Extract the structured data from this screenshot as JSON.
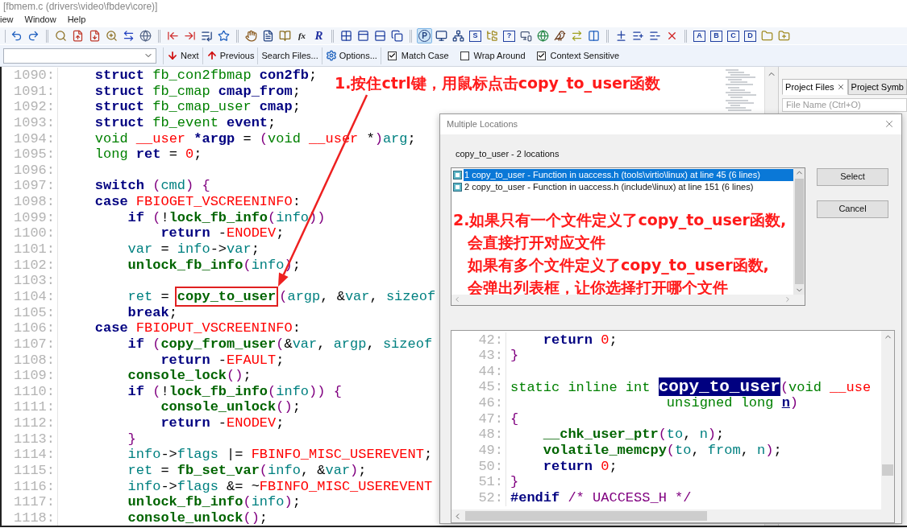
{
  "window": {
    "title": "[fbmem.c (drivers\\video\\fbdev\\core)]"
  },
  "menu": [
    "iew",
    "Window",
    "Help"
  ],
  "toolbar_groups": [
    [
      {
        "pressed": false
      },
      {
        "pressed": false
      }
    ],
    [
      {
        "pressed": false
      },
      {
        "pressed": false
      },
      {
        "pressed": false
      },
      {
        "pressed": false
      },
      {
        "pressed": false
      },
      {
        "pressed": false
      }
    ],
    [
      {
        "pressed": false
      },
      {
        "pressed": false
      },
      {
        "pressed": false
      },
      {
        "pressed": false
      }
    ],
    [
      {
        "pressed": false
      },
      {
        "pressed": false
      },
      {
        "pressed": false
      },
      {
        "pressed": false,
        "label": "fx"
      },
      {
        "pressed": false,
        "label": "R"
      }
    ],
    [
      {
        "pressed": false
      },
      {
        "pressed": false
      },
      {
        "pressed": false
      },
      {
        "pressed": false
      }
    ],
    [
      {
        "pressed": true,
        "label": "P"
      },
      {
        "pressed": false
      },
      {
        "pressed": false
      },
      {
        "pressed": false,
        "label": "S"
      },
      {
        "pressed": false
      },
      {
        "pressed": false,
        "label": "?"
      },
      {
        "pressed": false
      },
      {
        "pressed": false
      },
      {
        "pressed": false
      },
      {
        "pressed": false
      },
      {
        "pressed": false
      }
    ],
    [
      {
        "pressed": false
      },
      {
        "pressed": false
      },
      {
        "pressed": false
      },
      {
        "pressed": false
      }
    ],
    [
      {
        "pressed": false,
        "label": "A"
      },
      {
        "pressed": false,
        "label": "B"
      },
      {
        "pressed": false,
        "label": "C"
      },
      {
        "pressed": false,
        "label": "D"
      },
      {
        "pressed": false
      },
      {
        "pressed": false
      }
    ]
  ],
  "search_bar": {
    "buttons": [
      {
        "kind": "next",
        "label": "Next"
      },
      {
        "kind": "previous",
        "label": "Previous"
      },
      {
        "kind": "plain",
        "label": "Search Files..."
      },
      {
        "kind": "options",
        "label": "Options..."
      }
    ],
    "options": [
      {
        "label": "Match Case",
        "checked": true
      },
      {
        "label": "Wrap Around",
        "checked": false
      },
      {
        "label": "Context Sensitive",
        "checked": true
      }
    ]
  },
  "editor": {
    "lines": [
      {
        "number": "1090:",
        "tokens": [
          {
            "kind": "keyword",
            "text": "    struct "
          },
          {
            "kind": "type",
            "text": "fb_con2fbmap "
          },
          {
            "kind": "name",
            "text": "con2fb"
          },
          {
            "kind": "plain",
            "text": ";"
          }
        ]
      },
      {
        "number": "1091:",
        "tokens": [
          {
            "kind": "keyword",
            "text": "    struct "
          },
          {
            "kind": "type",
            "text": "fb_cmap "
          },
          {
            "kind": "name",
            "text": "cmap_from"
          },
          {
            "kind": "plain",
            "text": ";"
          }
        ]
      },
      {
        "number": "1092:",
        "tokens": [
          {
            "kind": "keyword",
            "text": "    struct "
          },
          {
            "kind": "type",
            "text": "fb_cmap_user "
          },
          {
            "kind": "name",
            "text": "cmap"
          },
          {
            "kind": "plain",
            "text": ";"
          }
        ]
      },
      {
        "number": "1093:",
        "tokens": [
          {
            "kind": "keyword",
            "text": "    struct "
          },
          {
            "kind": "type",
            "text": "fb_event "
          },
          {
            "kind": "name",
            "text": "event"
          },
          {
            "kind": "plain",
            "text": ";"
          }
        ]
      },
      {
        "number": "1094:",
        "tokens": [
          {
            "kind": "type",
            "text": "    void "
          },
          {
            "kind": "const",
            "text": "__user "
          },
          {
            "kind": "name",
            "text": "*argp"
          },
          {
            "kind": "plain",
            "text": " = "
          },
          {
            "kind": "paren",
            "text": "("
          },
          {
            "kind": "type",
            "text": "void "
          },
          {
            "kind": "const",
            "text": "__user "
          },
          {
            "kind": "plain",
            "text": "*"
          },
          {
            "kind": "paren",
            "text": ")"
          },
          {
            "kind": "ident",
            "text": "arg"
          },
          {
            "kind": "plain",
            "text": ";"
          }
        ]
      },
      {
        "number": "1095:",
        "tokens": [
          {
            "kind": "type",
            "text": "    long "
          },
          {
            "kind": "name",
            "text": "ret"
          },
          {
            "kind": "plain",
            "text": " = "
          },
          {
            "kind": "const",
            "text": "0"
          },
          {
            "kind": "plain",
            "text": ";"
          }
        ]
      },
      {
        "number": "1096:"
      },
      {
        "number": "1097:",
        "tokens": [
          {
            "kind": "keyword",
            "text": "    switch "
          },
          {
            "kind": "paren",
            "text": "("
          },
          {
            "kind": "ident",
            "text": "cmd"
          },
          {
            "kind": "paren",
            "text": ") {"
          }
        ]
      },
      {
        "number": "1098:",
        "tokens": [
          {
            "kind": "keyword",
            "text": "    case "
          },
          {
            "kind": "const",
            "text": "FBIOGET_VSCREENINFO"
          },
          {
            "kind": "plain",
            "text": ":"
          }
        ]
      },
      {
        "number": "1099:",
        "tokens": [
          {
            "kind": "keyword",
            "text": "        if "
          },
          {
            "kind": "paren",
            "text": "("
          },
          {
            "kind": "plain",
            "text": "!"
          },
          {
            "kind": "func",
            "text": "lock_fb_info"
          },
          {
            "kind": "paren",
            "text": "("
          },
          {
            "kind": "ident",
            "text": "info"
          },
          {
            "kind": "paren",
            "text": "))"
          }
        ]
      },
      {
        "number": "1100:",
        "tokens": [
          {
            "kind": "keyword",
            "text": "            return "
          },
          {
            "kind": "plain",
            "text": "-"
          },
          {
            "kind": "const",
            "text": "ENODEV"
          },
          {
            "kind": "plain",
            "text": ";"
          }
        ]
      },
      {
        "number": "1101:",
        "tokens": [
          {
            "kind": "ident",
            "text": "        var"
          },
          {
            "kind": "plain",
            "text": " = "
          },
          {
            "kind": "ident",
            "text": "info"
          },
          {
            "kind": "plain",
            "text": "->"
          },
          {
            "kind": "ident",
            "text": "var"
          },
          {
            "kind": "plain",
            "text": ";"
          }
        ]
      },
      {
        "number": "1102:",
        "tokens": [
          {
            "kind": "func",
            "text": "        unlock_fb_info"
          },
          {
            "kind": "paren",
            "text": "("
          },
          {
            "kind": "ident",
            "text": "info"
          },
          {
            "kind": "paren",
            "text": ")"
          },
          {
            "kind": "plain",
            "text": ";"
          }
        ]
      },
      {
        "number": "1103:"
      },
      {
        "number": "1104:",
        "tokens": [
          {
            "kind": "ident",
            "text": "        ret"
          },
          {
            "kind": "plain",
            "text": " = "
          },
          {
            "kind": "boxed",
            "text": "copy_to_user"
          },
          {
            "kind": "paren",
            "text": "("
          },
          {
            "kind": "ident",
            "text": "argp"
          },
          {
            "kind": "plain",
            "text": ", &"
          },
          {
            "kind": "ident",
            "text": "var"
          },
          {
            "kind": "plain",
            "text": ", "
          },
          {
            "kind": "ident",
            "text": "sizeof"
          }
        ]
      },
      {
        "number": "1105:",
        "tokens": [
          {
            "kind": "keyword",
            "text": "        break"
          },
          {
            "kind": "plain",
            "text": ";"
          }
        ]
      },
      {
        "number": "1106:",
        "tokens": [
          {
            "kind": "keyword",
            "text": "    case "
          },
          {
            "kind": "const",
            "text": "FBIOPUT_VSCREENINFO"
          },
          {
            "kind": "plain",
            "text": ":"
          }
        ]
      },
      {
        "number": "1107:",
        "tokens": [
          {
            "kind": "keyword",
            "text": "        if "
          },
          {
            "kind": "paren",
            "text": "("
          },
          {
            "kind": "func",
            "text": "copy_from_user"
          },
          {
            "kind": "paren",
            "text": "("
          },
          {
            "kind": "plain",
            "text": "&"
          },
          {
            "kind": "ident",
            "text": "var"
          },
          {
            "kind": "plain",
            "text": ", "
          },
          {
            "kind": "ident",
            "text": "argp"
          },
          {
            "kind": "plain",
            "text": ", "
          },
          {
            "kind": "ident",
            "text": "sizeof"
          }
        ]
      },
      {
        "number": "1108:",
        "tokens": [
          {
            "kind": "keyword",
            "text": "            return "
          },
          {
            "kind": "plain",
            "text": "-"
          },
          {
            "kind": "const",
            "text": "EFAULT"
          },
          {
            "kind": "plain",
            "text": ";"
          }
        ]
      },
      {
        "number": "1109:",
        "tokens": [
          {
            "kind": "func",
            "text": "        console_lock"
          },
          {
            "kind": "paren",
            "text": "()"
          },
          {
            "kind": "plain",
            "text": ";"
          }
        ]
      },
      {
        "number": "1110:",
        "tokens": [
          {
            "kind": "keyword",
            "text": "        if "
          },
          {
            "kind": "paren",
            "text": "("
          },
          {
            "kind": "plain",
            "text": "!"
          },
          {
            "kind": "func",
            "text": "lock_fb_info"
          },
          {
            "kind": "paren",
            "text": "("
          },
          {
            "kind": "ident",
            "text": "info"
          },
          {
            "kind": "paren",
            "text": ")) {"
          }
        ]
      },
      {
        "number": "1111:",
        "tokens": [
          {
            "kind": "func",
            "text": "            console_unlock"
          },
          {
            "kind": "paren",
            "text": "()"
          },
          {
            "kind": "plain",
            "text": ";"
          }
        ]
      },
      {
        "number": "1112:",
        "tokens": [
          {
            "kind": "keyword",
            "text": "            return "
          },
          {
            "kind": "plain",
            "text": "-"
          },
          {
            "kind": "const",
            "text": "ENODEV"
          },
          {
            "kind": "plain",
            "text": ";"
          }
        ]
      },
      {
        "number": "1113:",
        "tokens": [
          {
            "kind": "paren",
            "text": "        }"
          }
        ]
      },
      {
        "number": "1114:",
        "tokens": [
          {
            "kind": "ident",
            "text": "        info"
          },
          {
            "kind": "plain",
            "text": "->"
          },
          {
            "kind": "ident",
            "text": "flags"
          },
          {
            "kind": "plain",
            "text": " |= "
          },
          {
            "kind": "const",
            "text": "FBINFO_MISC_USEREVENT"
          },
          {
            "kind": "plain",
            "text": ";"
          }
        ]
      },
      {
        "number": "1115:",
        "tokens": [
          {
            "kind": "ident",
            "text": "        ret"
          },
          {
            "kind": "plain",
            "text": " = "
          },
          {
            "kind": "func",
            "text": "fb_set_var"
          },
          {
            "kind": "paren",
            "text": "("
          },
          {
            "kind": "ident",
            "text": "info"
          },
          {
            "kind": "plain",
            "text": ", &"
          },
          {
            "kind": "ident",
            "text": "var"
          },
          {
            "kind": "paren",
            "text": ")"
          },
          {
            "kind": "plain",
            "text": ";"
          }
        ]
      },
      {
        "number": "1116:",
        "tokens": [
          {
            "kind": "ident",
            "text": "        info"
          },
          {
            "kind": "plain",
            "text": "->"
          },
          {
            "kind": "ident",
            "text": "flags"
          },
          {
            "kind": "plain",
            "text": " &= ~"
          },
          {
            "kind": "const",
            "text": "FBINFO_MISC_USEREVENT"
          }
        ]
      },
      {
        "number": "1117:",
        "tokens": [
          {
            "kind": "func",
            "text": "        unlock_fb_info"
          },
          {
            "kind": "paren",
            "text": "("
          },
          {
            "kind": "ident",
            "text": "info"
          },
          {
            "kind": "paren",
            "text": ")"
          },
          {
            "kind": "plain",
            "text": ";"
          }
        ]
      },
      {
        "number": "1118:",
        "tokens": [
          {
            "kind": "func",
            "text": "        console_unlock"
          },
          {
            "kind": "paren",
            "text": "()"
          },
          {
            "kind": "plain",
            "text": ";"
          }
        ]
      }
    ]
  },
  "project_panel": {
    "tabs": [
      {
        "label": "Project Files",
        "selected": true
      },
      {
        "label": "Project Symb",
        "selected": false
      }
    ],
    "search": {
      "placeholder": "File Name (Ctrl+O)"
    }
  },
  "dialog": {
    "title": "Multiple Locations",
    "summary": "copy_to_user - 2 locations",
    "locations": [
      {
        "text": "1 copy_to_user - Function in uaccess.h (tools\\virtio\\linux) at line 45 (6 lines)",
        "selected": true
      },
      {
        "text": "2 copy_to_user - Function in uaccess.h (include\\linux) at line 151 (6 lines)",
        "selected": false
      }
    ],
    "buttons": [
      "Select",
      "Cancel"
    ],
    "preview": {
      "lines": [
        {
          "number": "42:",
          "tokens": [
            {
              "kind": "keyword",
              "text": "    return "
            },
            {
              "kind": "const",
              "text": "0"
            },
            {
              "kind": "plain",
              "text": ";"
            }
          ]
        },
        {
          "number": "43:",
          "tokens": [
            {
              "kind": "paren",
              "text": "}"
            }
          ]
        },
        {
          "number": "44:"
        },
        {
          "number": "45:",
          "tokens": [
            {
              "kind": "type",
              "text": "static inline int "
            },
            {
              "kind": "selected",
              "text": "copy_to_user"
            },
            {
              "kind": "paren",
              "text": "("
            },
            {
              "kind": "type",
              "text": "void "
            },
            {
              "kind": "const",
              "text": "__use"
            }
          ]
        },
        {
          "number": "46:",
          "tokens": [
            {
              "kind": "type",
              "text": "                   unsigned long "
            },
            {
              "kind": "underlined",
              "text": "n"
            },
            {
              "kind": "paren",
              "text": ")"
            }
          ]
        },
        {
          "number": "47:",
          "tokens": [
            {
              "kind": "paren",
              "text": "{"
            }
          ]
        },
        {
          "number": "48:",
          "tokens": [
            {
              "kind": "func",
              "text": "    __chk_user_ptr"
            },
            {
              "kind": "paren",
              "text": "("
            },
            {
              "kind": "ident",
              "text": "to"
            },
            {
              "kind": "plain",
              "text": ", "
            },
            {
              "kind": "ident",
              "text": "n"
            },
            {
              "kind": "paren",
              "text": ")"
            },
            {
              "kind": "plain",
              "text": ";"
            }
          ]
        },
        {
          "number": "49:",
          "tokens": [
            {
              "kind": "func",
              "text": "    volatile_memcpy"
            },
            {
              "kind": "paren",
              "text": "("
            },
            {
              "kind": "ident",
              "text": "to"
            },
            {
              "kind": "plain",
              "text": ", "
            },
            {
              "kind": "ident",
              "text": "from"
            },
            {
              "kind": "plain",
              "text": ", "
            },
            {
              "kind": "ident",
              "text": "n"
            },
            {
              "kind": "paren",
              "text": ")"
            },
            {
              "kind": "plain",
              "text": ";"
            }
          ]
        },
        {
          "number": "50:",
          "tokens": [
            {
              "kind": "keyword",
              "text": "    return "
            },
            {
              "kind": "const",
              "text": "0"
            },
            {
              "kind": "plain",
              "text": ";"
            }
          ]
        },
        {
          "number": "51:",
          "tokens": [
            {
              "kind": "paren",
              "text": "}"
            }
          ]
        },
        {
          "number": "52:",
          "tokens": [
            {
              "kind": "keyword",
              "text": "#endif "
            },
            {
              "kind": "comment",
              "text": "/* UACCESS_H */"
            }
          ]
        }
      ]
    }
  },
  "annotations": {
    "step_1": "1.按住ctrl键，用鼠标点击copy_to_user函数",
    "step_2": [
      "2.如果只有一个文件定义了copy_to_user函数,",
      "会直接打开对应文件",
      "如果有多个文件定义了copy_to_user函数,",
      "会弹出列表框，让你选择打开哪个文件"
    ]
  }
}
